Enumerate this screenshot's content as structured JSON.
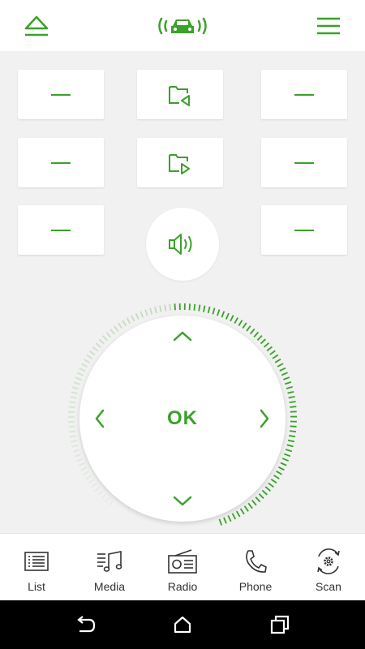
{
  "colors": {
    "accent": "#3aa12a",
    "background": "#f1f1f1",
    "surface": "#ffffff",
    "system_bar": "#000000"
  },
  "top_bar": {
    "left_icon": "eject-icon",
    "center_icon": "car-connected-icon",
    "right_icon": "menu-icon"
  },
  "tiles": {
    "row1": [
      "dash-icon",
      "folder-previous-icon",
      "dash-icon"
    ],
    "row2": [
      "dash-icon",
      "folder-next-icon",
      "dash-icon"
    ],
    "row3": [
      "dash-icon",
      "volume-icon",
      "dash-icon"
    ]
  },
  "dpad": {
    "center_label": "OK",
    "volume_level": 0.45
  },
  "bottom_nav": [
    {
      "label": "List",
      "icon": "list-icon"
    },
    {
      "label": "Media",
      "icon": "media-icon"
    },
    {
      "label": "Radio",
      "icon": "radio-icon"
    },
    {
      "label": "Phone",
      "icon": "phone-icon"
    },
    {
      "label": "Scan",
      "icon": "scan-icon"
    }
  ],
  "system_nav": [
    "back-icon",
    "home-icon",
    "recents-icon"
  ]
}
